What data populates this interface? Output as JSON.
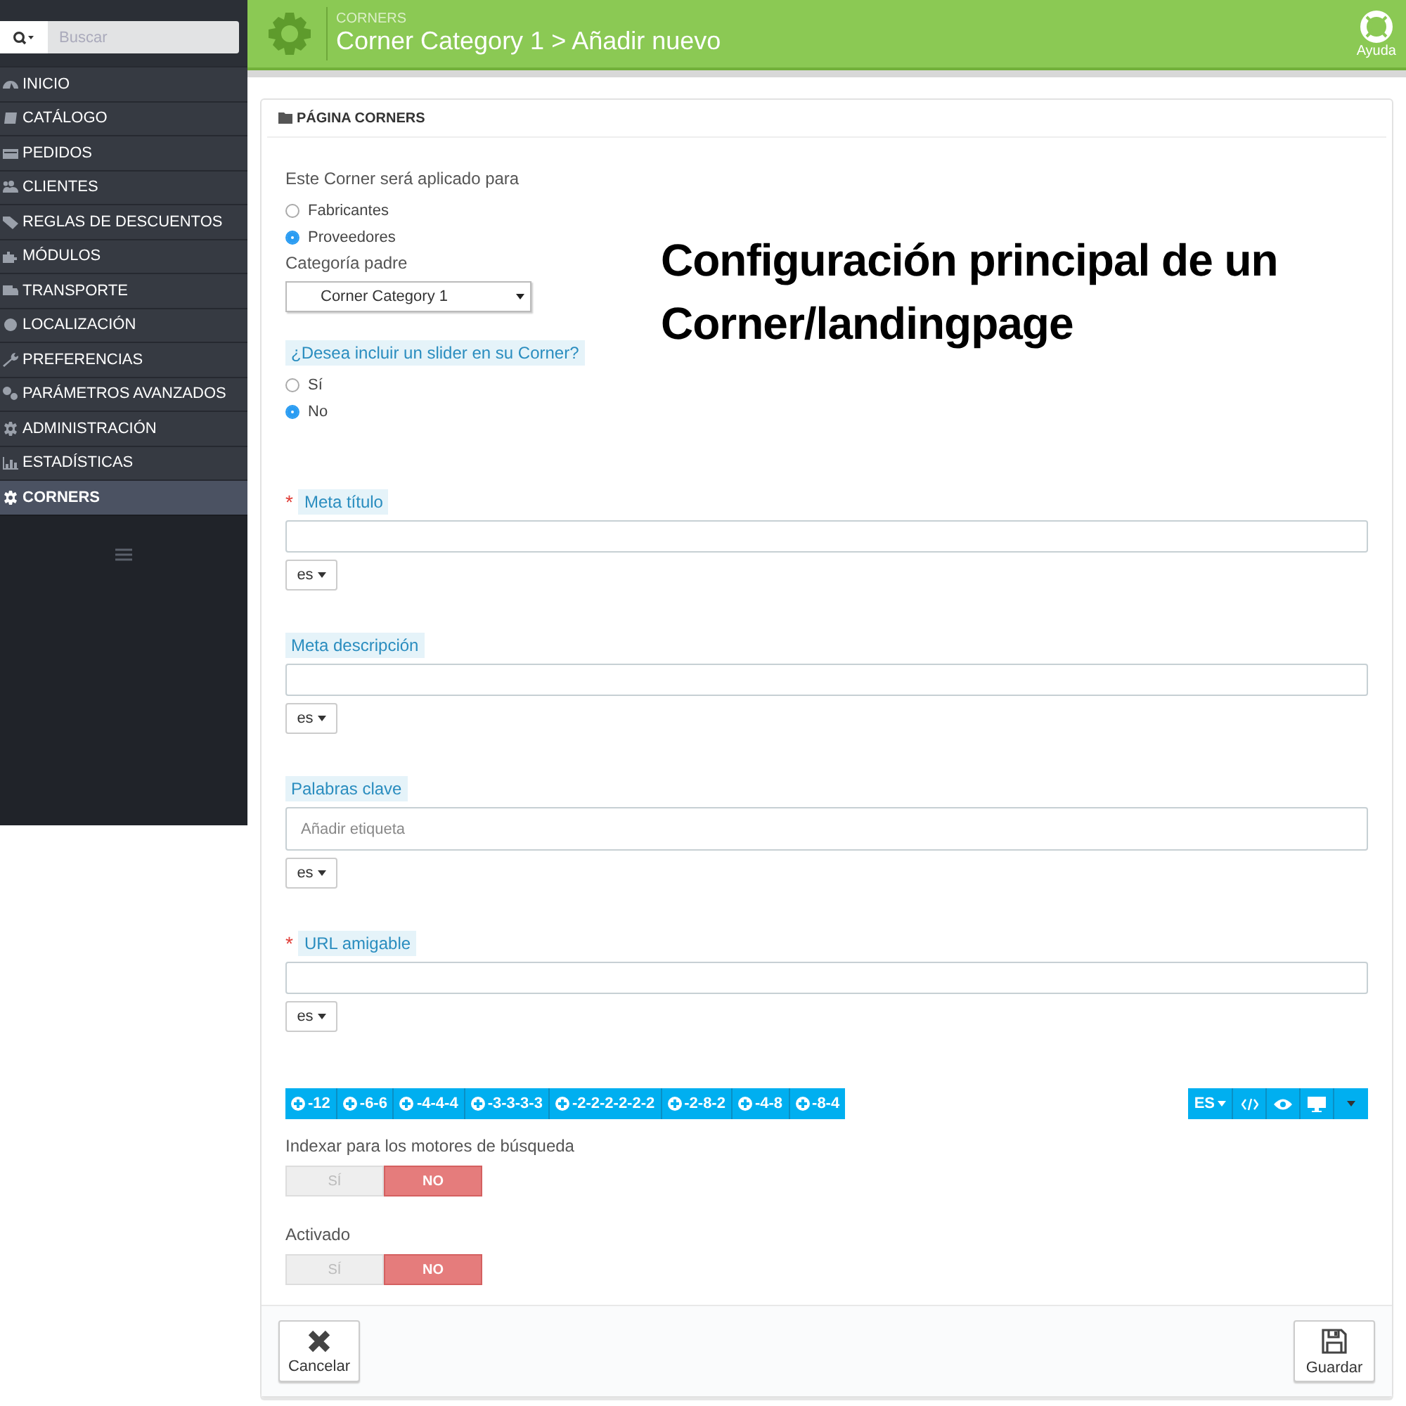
{
  "search": {
    "placeholder": "Buscar"
  },
  "sidebar": {
    "items": [
      {
        "label": "INICIO",
        "selected": false
      },
      {
        "label": "CATÁLOGO",
        "selected": false
      },
      {
        "label": "PEDIDOS",
        "selected": false
      },
      {
        "label": "CLIENTES",
        "selected": false
      },
      {
        "label": "REGLAS DE DESCUENTOS",
        "selected": false
      },
      {
        "label": "MÓDULOS",
        "selected": false
      },
      {
        "label": "TRANSPORTE",
        "selected": false
      },
      {
        "label": "LOCALIZACIÓN",
        "selected": false
      },
      {
        "label": "PREFERENCIAS",
        "selected": false
      },
      {
        "label": "PARÁMETROS AVANZADOS",
        "selected": false
      },
      {
        "label": "ADMINISTRACIÓN",
        "selected": false
      },
      {
        "label": "ESTADÍSTICAS",
        "selected": false
      },
      {
        "label": "CORNERS",
        "selected": true
      }
    ]
  },
  "header": {
    "breadcrumb": "CORNERS",
    "title": "Corner Category 1 > Añadir nuevo",
    "help": "Ayuda"
  },
  "annotation": "Configuración principal de un Corner/landingpage",
  "panel": {
    "title": "PÁGINA CORNERS",
    "fields": [
      {
        "kind": "radio",
        "label": "Este Corner será aplicado para",
        "highlighted": false,
        "options": [
          {
            "label": "Fabricantes",
            "selected": false
          },
          {
            "label": "Proveedores",
            "selected": true
          }
        ]
      },
      {
        "kind": "select",
        "label": "Categoría padre",
        "highlighted": false,
        "value": "Corner Category 1"
      },
      {
        "kind": "radio",
        "label": "¿Desea incluir un slider en su Corner?",
        "highlighted": true,
        "options": [
          {
            "label": "Sí",
            "selected": false
          },
          {
            "label": "No",
            "selected": true
          }
        ]
      },
      {
        "kind": "text",
        "marker": "*",
        "label": "Meta título",
        "highlighted": true,
        "lang": "es"
      },
      {
        "kind": "text",
        "label": "Meta descripción",
        "highlighted": true,
        "lang": "es"
      },
      {
        "kind": "tags",
        "label": "Palabras clave",
        "highlighted": true,
        "placeholder": "Añadir etiqueta",
        "lang": "es"
      },
      {
        "kind": "text",
        "marker": "*",
        "label": "URL amigable",
        "highlighted": true,
        "lang": "es"
      },
      {
        "kind": "toolbar",
        "buttons": [
          "-12",
          "-6-6",
          "-4-4-4",
          "-3-3-3-3",
          "-2-2-2-2-2-2",
          "-2-8-2",
          "-4-8",
          "-8-4"
        ],
        "lang": "ES"
      },
      {
        "kind": "switch",
        "label": "Indexar para los motores de búsqueda",
        "highlighted": false,
        "options": [
          {
            "label": "SÍ",
            "selected": false
          },
          {
            "label": "NO",
            "selected": true
          }
        ]
      },
      {
        "kind": "switch",
        "label": "Activado",
        "highlighted": false,
        "options": [
          {
            "label": "SÍ",
            "selected": false
          },
          {
            "label": "NO",
            "selected": true
          }
        ]
      }
    ],
    "footer": {
      "cancel": "Cancelar",
      "save": "Guardar"
    }
  }
}
